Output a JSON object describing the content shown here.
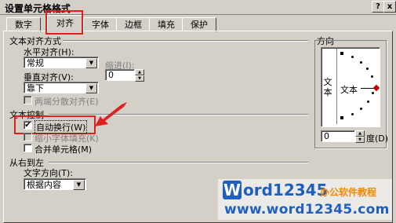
{
  "window": {
    "title": "设置单元格格式",
    "help_label": "?",
    "close_label": "x"
  },
  "tabs": [
    {
      "label": "数字"
    },
    {
      "label": "对齐"
    },
    {
      "label": "字体"
    },
    {
      "label": "边框"
    },
    {
      "label": "填充"
    },
    {
      "label": "保护"
    }
  ],
  "text_alignment": {
    "group_title": "文本对齐方式",
    "horizontal_label": "水平对齐(H):",
    "horizontal_value": "常规",
    "indent_label": "缩进(I):",
    "indent_value": "0",
    "vertical_label": "垂直对齐(V):",
    "vertical_value": "靠下",
    "distributed_label": "两端分散对齐(E)"
  },
  "text_control": {
    "group_title": "文本控制",
    "wrap_label": "自动换行(W)",
    "wrap_checked": true,
    "shrink_label": "缩小字体填充(K)",
    "merge_label": "合并单元格(M)"
  },
  "rtl": {
    "group_title": "从右到左",
    "direction_label": "文字方向(T):",
    "direction_value": "根据内容"
  },
  "orientation": {
    "group_title": "方向",
    "vertical_text": "文本",
    "horizontal_text": "文本",
    "degree_value": "0",
    "degree_label": "度(D)"
  },
  "watermark": {
    "brand_w": "W",
    "brand_rest": "ord12345",
    "tagline": "办公软件教程",
    "url": "www.word12345.com"
  },
  "colors": {
    "highlight": "#e02020",
    "watermark_blue": "#1f5fbf",
    "watermark_orange": "#f08a00"
  }
}
